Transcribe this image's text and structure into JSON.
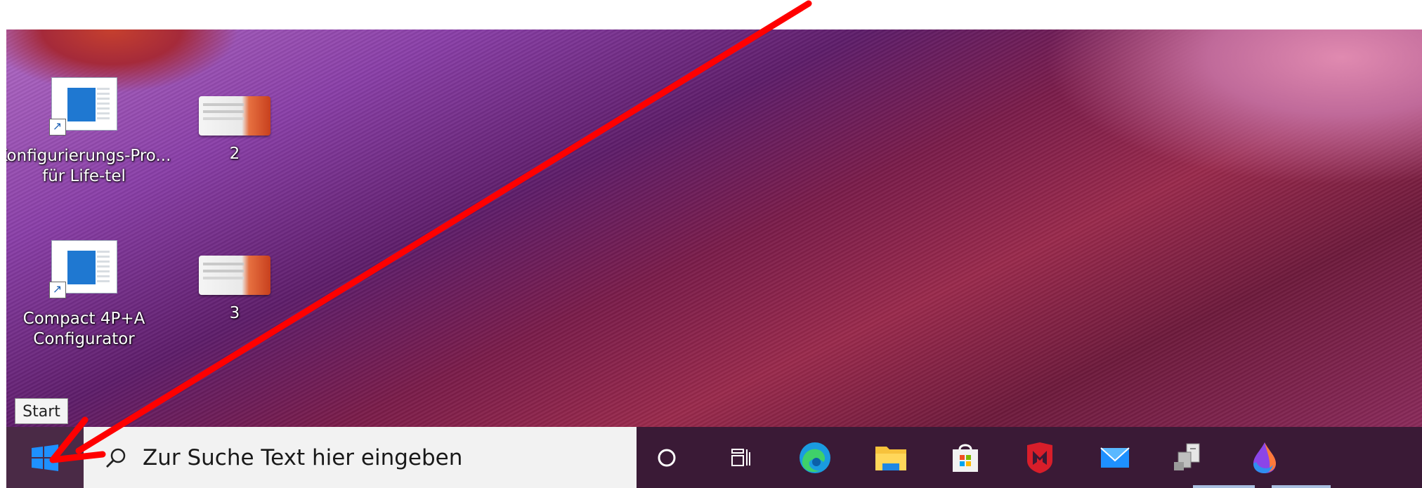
{
  "desktop": {
    "icons": [
      {
        "name": "config-program-icon",
        "line1": "Konfigurierungs-Pro...",
        "line2": "für Life-tel"
      },
      {
        "name": "folder-2-icon",
        "label": "2"
      },
      {
        "name": "compact-configurator-icon",
        "line1": "Compact 4P+A",
        "line2": "Configurator"
      },
      {
        "name": "folder-3-icon",
        "label": "3"
      }
    ]
  },
  "tooltip": {
    "text": "Start"
  },
  "taskbar": {
    "search_placeholder": "Zur Suche Text hier eingeben",
    "pinned": [
      "cortana-icon",
      "task-view-icon",
      "edge-icon",
      "file-explorer-icon",
      "store-icon",
      "mcafee-icon",
      "mail-icon",
      "network-app-icon",
      "paint-icon"
    ]
  },
  "annotation": {
    "arrow_color": "#ff0000"
  },
  "colors": {
    "taskbar": "#3a1a36",
    "start_blue": "#1e90ff"
  }
}
